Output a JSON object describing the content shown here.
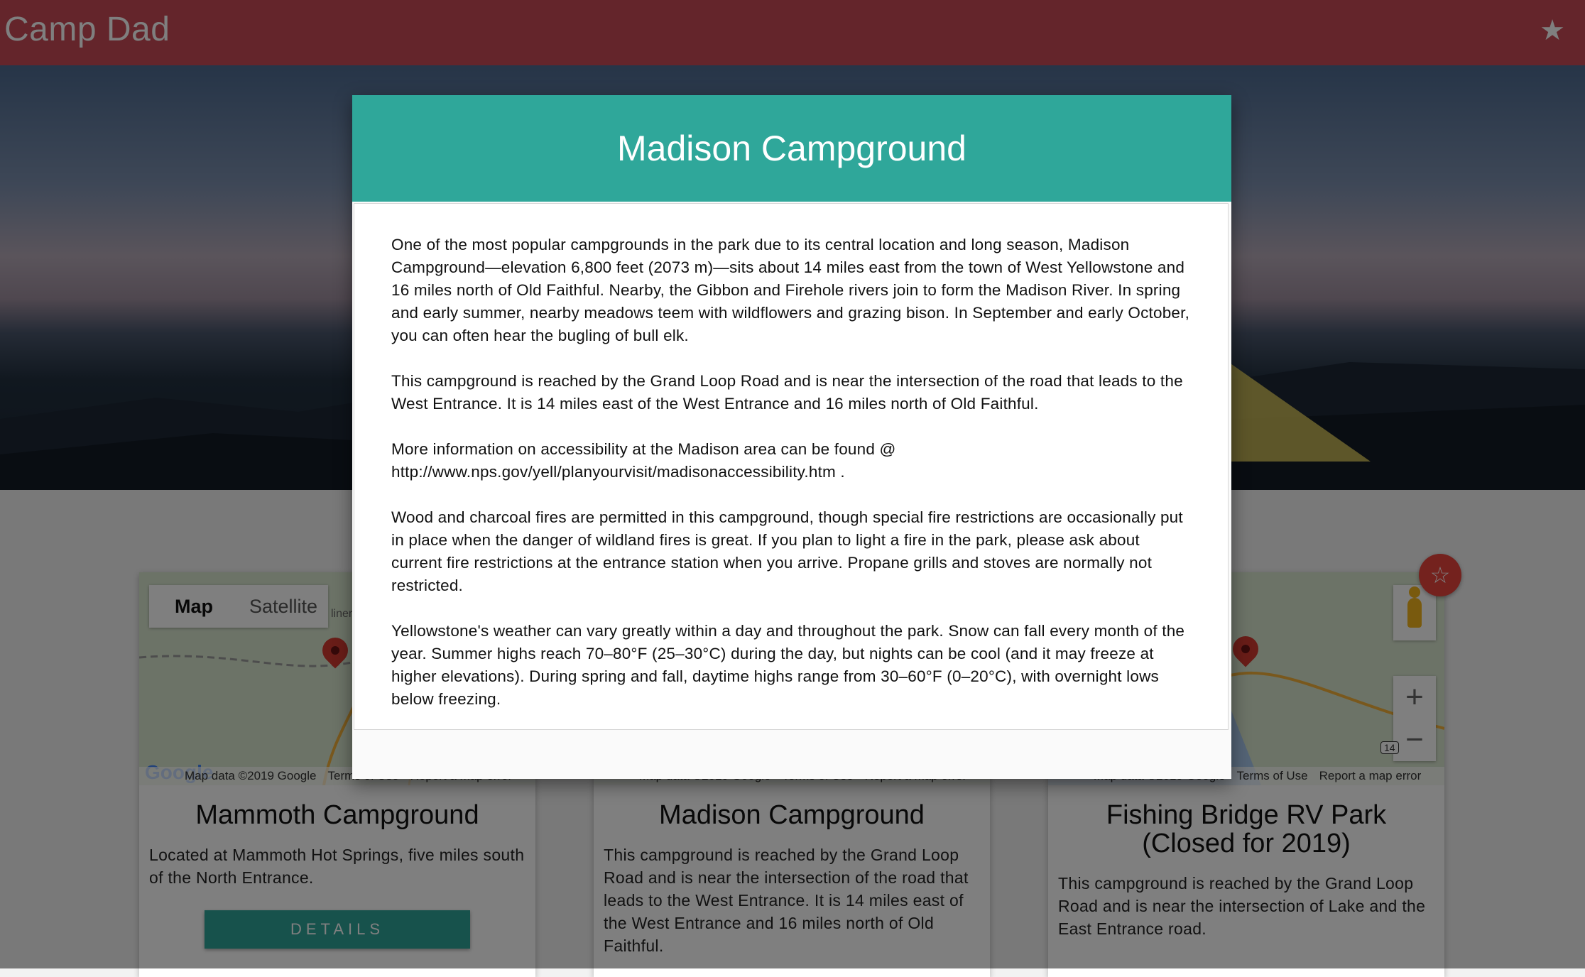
{
  "app": {
    "title": "Camp Dad"
  },
  "icons": {
    "favorites": "star-icon",
    "favorite_fab": "star-outline-icon"
  },
  "colors": {
    "header": "#c84b56",
    "accent": "#2fa79a",
    "fab": "#e8453c"
  },
  "cards": [
    {
      "title": "Mammoth Campground",
      "description": "Located at Mammoth Hot Springs, five miles south of the North Entrance.",
      "button": "DETAILS",
      "map": {
        "map_tab": "Map",
        "satellite_tab": "Satellite",
        "attribution": "Map data ©2019 Google",
        "terms": "Terms of Use",
        "report": "Report a map error",
        "logo": "Google",
        "place_fragment": "liner"
      }
    },
    {
      "title": "Madison Campground",
      "description": "This campground is reached by the Grand Loop Road and is near the intersection of the road that leads to the West Entrance. It is 14 miles east of the West Entrance and 16 miles north of Old Faithful.",
      "map": {
        "attribution": "Map data ©2019 Google",
        "terms": "Terms of Use",
        "report": "Report a map error"
      }
    },
    {
      "title": "Fishing Bridge RV Park (Closed for 2019)",
      "description": "This campground is reached by the Grand Loop Road and is near the intersection of Lake and the East Entrance road.",
      "map": {
        "attribution": "Map data ©2019 Google",
        "terms": "Terms of Use",
        "report": "Report a map error",
        "zoom_in": "+",
        "zoom_out": "−",
        "route_shield": "14"
      }
    }
  ],
  "modal": {
    "title": "Madison Campground",
    "paragraphs": [
      "One of the most popular campgrounds in the park due to its central location and long season, Madison Campground—elevation 6,800 feet (2073 m)—sits about 14 miles east from the town of West Yellowstone and 16 miles north of Old Faithful. Nearby, the Gibbon and Firehole rivers join to form the Madison River. In spring and early summer, nearby meadows teem with wildflowers and grazing bison. In September and early October, you can often hear the bugling of bull elk.",
      "This campground is reached by the Grand Loop Road and is near the intersection of the road that leads to the West Entrance. It is 14 miles east of the West Entrance and 16 miles north of Old Faithful.",
      "More information on accessibility at the Madison area can be found @ http://www.nps.gov/yell/planyourvisit/madisonaccessibility.htm .",
      "Wood and charcoal fires are permitted in this campground, though special fire restrictions are occasionally put in place when the danger of wildland fires is great. If you plan to light a fire in the park, please ask about current fire restrictions at the entrance station when you arrive. Propane grills and stoves are normally not restricted.",
      "Yellowstone's weather can vary greatly within a day and throughout the park. Snow can fall every month of the year. Summer highs reach 70–80°F (25–30°C) during the day, but nights can be cool (and it may freeze at higher elevations). During spring and fall, daytime highs range from 30–60°F (0–20°C), with overnight lows below freezing."
    ]
  }
}
